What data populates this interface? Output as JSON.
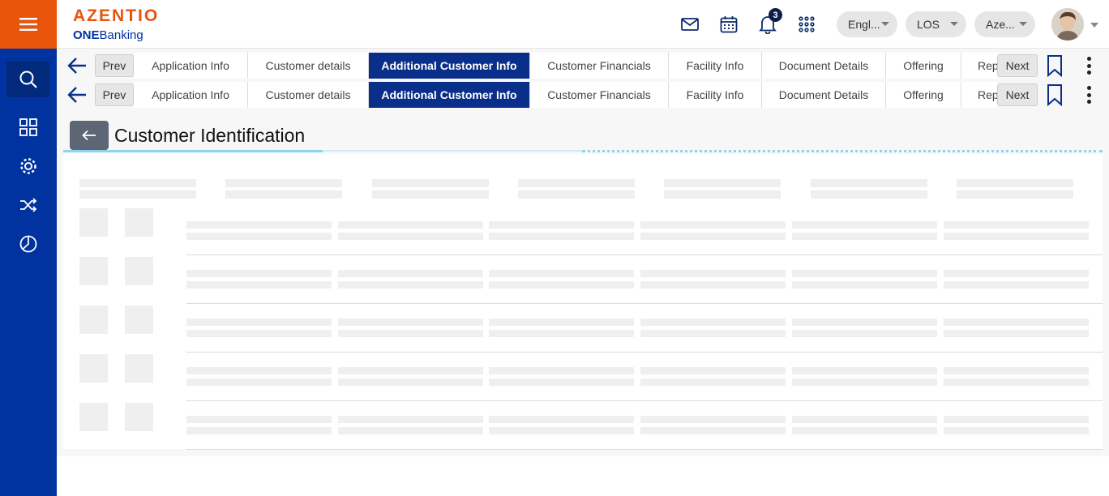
{
  "header": {
    "logo_text": "AZENTIO",
    "logo_sub_bold": "ONE",
    "logo_sub_rest": "Banking",
    "notification_count": "3",
    "language_selector": "Engl...",
    "module_selector": "LOS",
    "entity_selector": "Aze...",
    "icons": [
      "mail-icon",
      "calendar-icon",
      "bell-icon",
      "apps-grid-icon"
    ]
  },
  "sidebar": {
    "items": [
      "search-icon",
      "dashboard-icon",
      "settings-icon",
      "shuffle-icon",
      "pie-chart-icon"
    ],
    "active_index": 1
  },
  "tab_rows": [
    {
      "prev_label": "Prev",
      "next_label": "Next",
      "tabs": [
        "Application Info",
        "Customer details",
        "Additional Customer Info",
        "Customer Financials",
        "Facility Info",
        "Document Details",
        "Offering",
        "Rep"
      ],
      "active_tab": "Additional Customer Info"
    },
    {
      "prev_label": "Prev",
      "next_label": "Next",
      "tabs": [
        "Application Info",
        "Customer details",
        "Additional Customer Info",
        "Customer Financials",
        "Facility Info",
        "Document Details",
        "Offering",
        "Rep"
      ],
      "active_tab": "Additional Customer Info"
    }
  ],
  "page": {
    "title": "Customer Identification"
  },
  "colors": {
    "brand_orange": "#e8540c",
    "sidebar_blue": "#0033a0",
    "active_tab": "#0a2f8a",
    "accent_line": "#8fd3f3"
  }
}
